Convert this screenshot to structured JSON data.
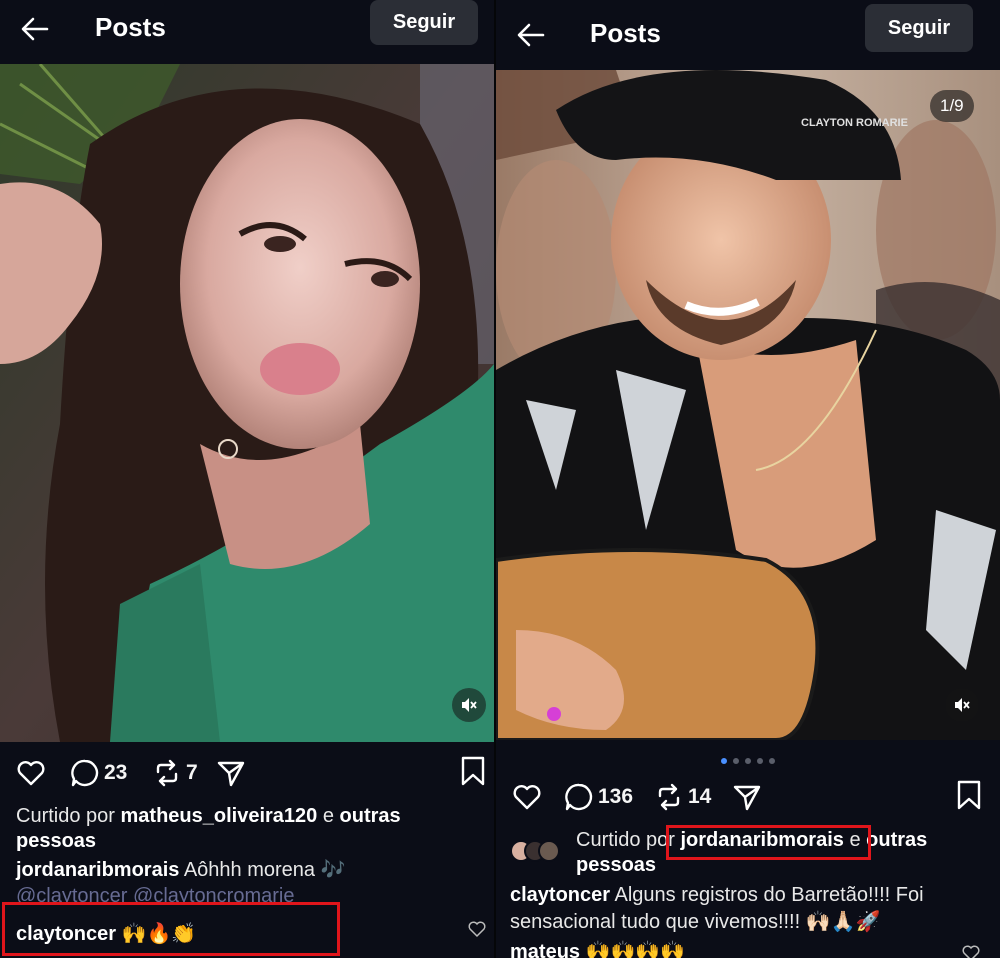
{
  "left": {
    "header": {
      "title": "Posts",
      "follow_label": "Seguir"
    },
    "actions": {
      "comments": "23",
      "reposts": "7"
    },
    "liked": {
      "prefix": "Curtido por",
      "user": "matheus_oliveira120",
      "joiner": "e",
      "others": "outras pessoas"
    },
    "caption": {
      "user": "jordanaribmorais",
      "text": "Aôhhh morena 🎶",
      "mentions": "@claytoncer @claytoncromarie"
    },
    "comment": {
      "user": "claytoncer",
      "text": "🙌🔥👏"
    },
    "accent": "#e0151b"
  },
  "right": {
    "header": {
      "title": "Posts",
      "follow_label": "Seguir"
    },
    "media": {
      "counter": "1/9",
      "cap_text": "CLAYTON ROMARIE",
      "carousel_count": 5,
      "carousel_active": 0
    },
    "actions": {
      "comments": "136",
      "reposts": "14"
    },
    "liked": {
      "prefix": "Curtido p",
      "prefix_boxed": "or ",
      "user": "jordanaribmorais",
      "joiner": "e",
      "others": "outras pessoas"
    },
    "caption": {
      "user": "claytoncer",
      "text": "Alguns registros do Barretão!!!! Foi sensacional tudo que vivemos!!!! 🙌🏻🙏🏻🚀"
    },
    "next_comment": {
      "user": "mateus",
      "text": "🙌🙌🙌🙌"
    }
  }
}
